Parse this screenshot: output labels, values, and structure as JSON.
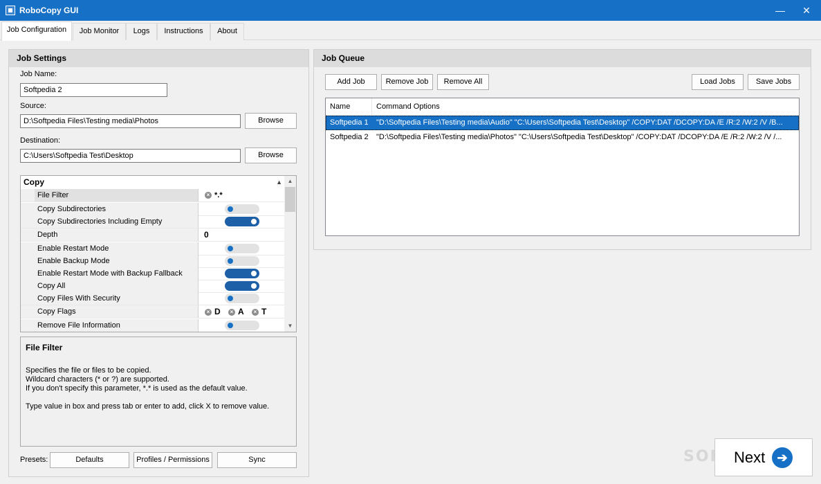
{
  "window": {
    "title": "RoboCopy GUI",
    "minimize": "—",
    "close": "✕"
  },
  "tabs": [
    "Job Configuration",
    "Job Monitor",
    "Logs",
    "Instructions",
    "About"
  ],
  "job_settings": {
    "title": "Job Settings",
    "job_name_label": "Job Name:",
    "job_name_value": "Softpedia 2",
    "source_label": "Source:",
    "source_value": "D:\\Softpedia Files\\Testing media\\Photos",
    "destination_label": "Destination:",
    "destination_value": "C:\\Users\\Softpedia Test\\Desktop",
    "browse_label": "Browse"
  },
  "property_grid": {
    "category": "Copy",
    "rows": [
      {
        "name": "File Filter",
        "type": "filter",
        "value": "*.*",
        "selected": true
      },
      {
        "name": "Copy Subdirectories",
        "type": "toggle",
        "on": false
      },
      {
        "name": "Copy Subdirectories Including Empty",
        "type": "toggle",
        "on": true
      },
      {
        "name": "Depth",
        "type": "number",
        "value": "0"
      },
      {
        "name": "Enable Restart Mode",
        "type": "toggle",
        "on": false
      },
      {
        "name": "Enable Backup Mode",
        "type": "toggle",
        "on": false
      },
      {
        "name": "Enable Restart Mode with Backup Fallback",
        "type": "toggle",
        "on": true
      },
      {
        "name": "Copy All",
        "type": "toggle",
        "on": true
      },
      {
        "name": "Copy Files With Security",
        "type": "toggle",
        "on": false
      },
      {
        "name": "Copy Flags",
        "type": "flags",
        "flags": [
          "D",
          "A",
          "T"
        ]
      },
      {
        "name": "Remove File Information",
        "type": "toggle",
        "on": false
      }
    ]
  },
  "help": {
    "title": "File Filter",
    "lines": [
      "Specifies the file or files to be copied.",
      "Wildcard characters (* or ?) are supported.",
      "If you don't specify this parameter, *.* is used as the default value.",
      "",
      "Type value in box and press tab or enter to add, click X to remove value."
    ]
  },
  "presets": {
    "label": "Presets:",
    "buttons": [
      "Defaults",
      "Profiles / Permissions",
      "Sync"
    ]
  },
  "job_queue": {
    "title": "Job Queue",
    "buttons": {
      "add": "Add Job",
      "remove": "Remove Job",
      "remove_all": "Remove All",
      "load": "Load Jobs",
      "save": "Save Jobs"
    },
    "columns": [
      "Name",
      "Command Options"
    ],
    "rows": [
      {
        "name": "Softpedia 1",
        "options": "\"D:\\Softpedia Files\\Testing media\\Audio\" \"C:\\Users\\Softpedia Test\\Desktop\"  /COPY:DAT /DCOPY:DA /E /R:2 /W:2 /V /B...",
        "selected": true
      },
      {
        "name": "Softpedia 2",
        "options": "\"D:\\Softpedia Files\\Testing media\\Photos\" \"C:\\Users\\Softpedia Test\\Desktop\"  /COPY:DAT /DCOPY:DA /E /R:2 /W:2 /V /...",
        "selected": false
      }
    ]
  },
  "next_button": {
    "label": "Next",
    "icon": "arrow-right-icon"
  },
  "watermark": "SOFTPEDIA",
  "colors": {
    "accent": "#1670c5",
    "toggle_on": "#1d60a8"
  }
}
